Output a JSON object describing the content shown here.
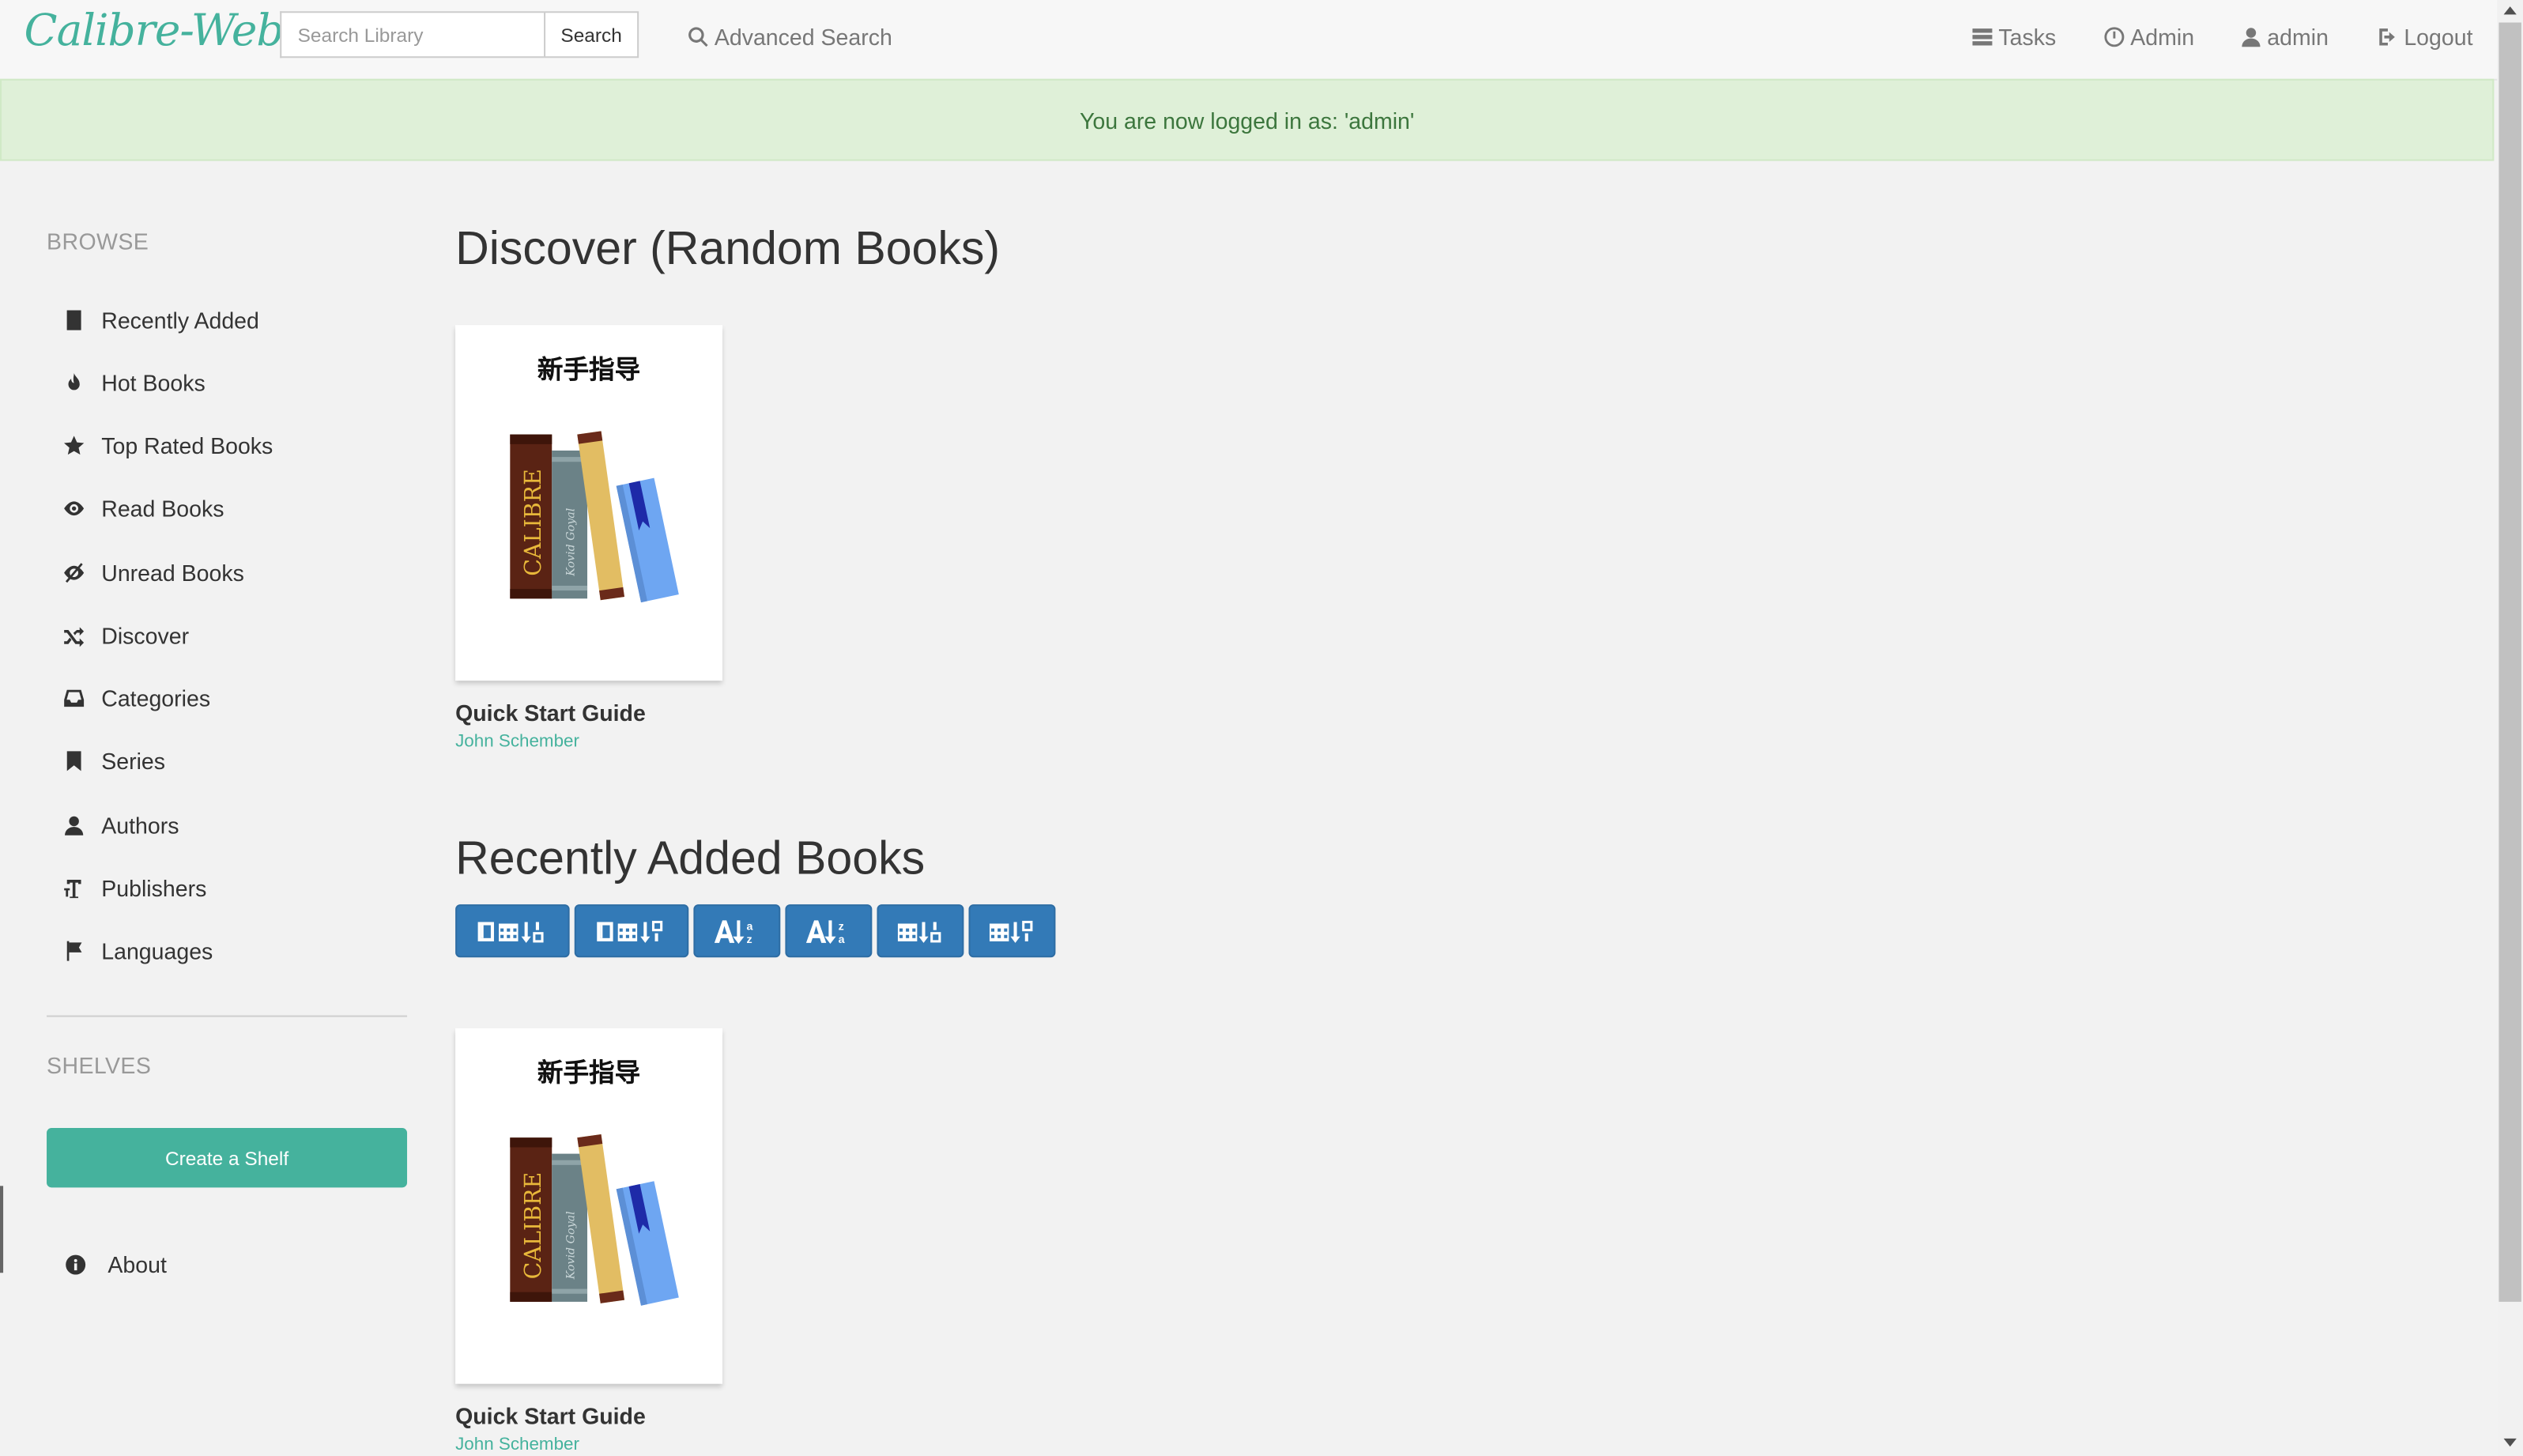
{
  "brand": "Calibre-Web",
  "search": {
    "placeholder": "Search Library",
    "button_label": "Search"
  },
  "nav": {
    "advanced_search": "Advanced Search",
    "tasks": "Tasks",
    "admin": "Admin",
    "user": "admin",
    "logout": "Logout"
  },
  "alert": "You are now logged in as: 'admin'",
  "sidebar": {
    "browse_heading": "BROWSE",
    "items": [
      {
        "label": "Recently Added",
        "icon": "book-icon"
      },
      {
        "label": "Hot Books",
        "icon": "fire-icon"
      },
      {
        "label": "Top Rated Books",
        "icon": "star-icon"
      },
      {
        "label": "Read Books",
        "icon": "eye-icon"
      },
      {
        "label": "Unread Books",
        "icon": "eye-slash-icon"
      },
      {
        "label": "Discover",
        "icon": "shuffle-icon"
      },
      {
        "label": "Categories",
        "icon": "inbox-icon"
      },
      {
        "label": "Series",
        "icon": "bookmark-icon"
      },
      {
        "label": "Authors",
        "icon": "user-icon"
      },
      {
        "label": "Publishers",
        "icon": "text-size-icon"
      },
      {
        "label": "Languages",
        "icon": "flag-icon"
      }
    ],
    "shelves_heading": "SHELVES",
    "create_shelf": "Create a Shelf",
    "about": "About"
  },
  "main": {
    "discover_title": "Discover (Random Books)",
    "recent_title": "Recently Added Books",
    "discover_books": [
      {
        "cover_title": "新手指导",
        "title": "Quick Start Guide",
        "author": "John Schember"
      }
    ],
    "recent_books": [
      {
        "cover_title": "新手指导",
        "title": "Quick Start Guide",
        "author": "John Schember"
      }
    ],
    "sort_buttons": [
      {
        "icon": "sort-book-date-asc-icon"
      },
      {
        "icon": "sort-book-date-desc-icon"
      },
      {
        "icon": "sort-alpha-asc-icon"
      },
      {
        "icon": "sort-alpha-desc-icon"
      },
      {
        "icon": "sort-date-asc-icon"
      },
      {
        "icon": "sort-date-desc-icon"
      }
    ],
    "cover_spine_text": [
      "CALIBRE",
      "Kovid Goyal"
    ]
  },
  "colors": {
    "accent": "#45b29d",
    "primary_button": "#337ab7",
    "alert_bg": "#dff0d8",
    "alert_text": "#3c763d"
  }
}
